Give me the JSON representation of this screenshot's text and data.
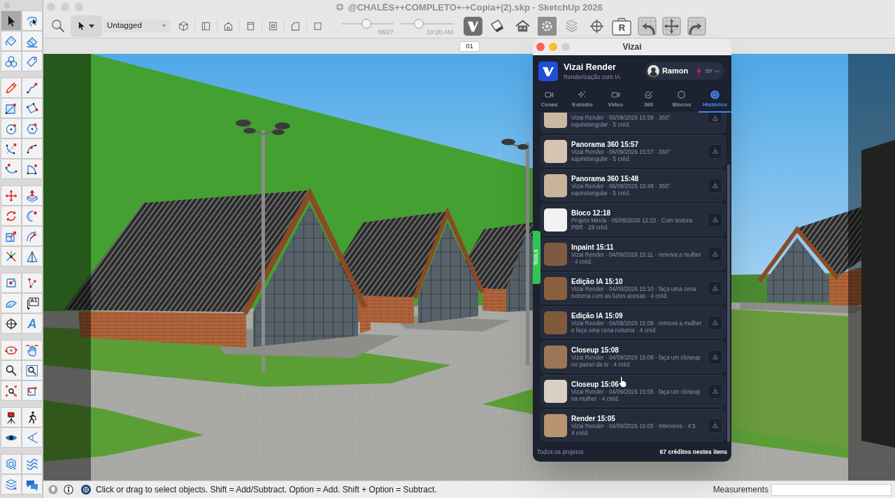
{
  "tool_palette": {
    "groups": [
      {
        "tools": [
          {
            "selected": true
          },
          {
            "selected": false
          },
          {
            "selected": false
          },
          {
            "selected": false
          },
          {
            "selected": false
          },
          {
            "selected": false
          }
        ]
      },
      {
        "tools": [
          {
            "selected": false
          },
          {
            "selected": false
          },
          {
            "selected": false
          },
          {
            "selected": false
          },
          {
            "selected": false
          },
          {
            "selected": false
          },
          {
            "selected": false
          },
          {
            "selected": false
          },
          {
            "selected": false
          },
          {
            "selected": false
          }
        ]
      },
      {
        "tools": [
          {
            "selected": false
          },
          {
            "selected": false
          },
          {
            "selected": false
          },
          {
            "selected": false
          },
          {
            "selected": false
          },
          {
            "selected": false
          },
          {
            "selected": false
          },
          {
            "selected": false
          }
        ]
      },
      {
        "tools": [
          {
            "selected": false
          },
          {
            "selected": false
          },
          {
            "selected": false
          },
          {
            "selected": false,
            "label": "A1"
          },
          {
            "selected": false
          },
          {
            "selected": false,
            "label": "A"
          }
        ]
      },
      {
        "tools": [
          {
            "selected": false
          },
          {
            "selected": false
          },
          {
            "selected": false
          },
          {
            "selected": false
          },
          {
            "selected": false
          },
          {
            "selected": false
          }
        ]
      },
      {
        "tools": [
          {
            "selected": false
          },
          {
            "selected": false
          },
          {
            "selected": false
          },
          {
            "selected": false
          }
        ]
      },
      {
        "tools": [
          {
            "selected": false
          },
          {
            "selected": false
          },
          {
            "selected": false
          },
          {
            "selected": false
          }
        ]
      }
    ]
  },
  "window": {
    "title": "@CHALÉS++COMPLETO+-+Copia+(2).skp - SketchUp 2026"
  },
  "toolbar": {
    "tag_dropdown": {
      "value": "Untagged"
    },
    "shadow_sliders": [
      {
        "level": 0.48,
        "reading": "08/27"
      },
      {
        "level": 0.35,
        "reading": "10:20 AM"
      }
    ],
    "render_camera_label": "R"
  },
  "scene_tabs": [
    {
      "label": "01"
    }
  ],
  "vizai": {
    "window_title": "Vizai",
    "brand": {
      "name": "Vizai Render",
      "tagline": "Renderização com IA"
    },
    "user": {
      "name": "Ramon",
      "credits": "59"
    },
    "tabs": [
      {
        "label": "Cenas",
        "selected": false
      },
      {
        "label": "Estúdio",
        "selected": false
      },
      {
        "label": "Vídeo",
        "selected": false
      },
      {
        "label": "360",
        "selected": false
      },
      {
        "label": "Blocos",
        "selected": false
      },
      {
        "label": "Histórico",
        "selected": true
      }
    ],
    "history": [
      {
        "details": "Vizai Render · 06/09/2026 15:59 · 360° equiretangular · 5 créd."
      },
      {
        "title": "Panorama 360 15:57",
        "details": "Vizai Render · 06/09/2026 15:57 · 360° equiretangular · 5 créd."
      },
      {
        "title": "Panorama 360 15:48",
        "details": "Vizai Render · 06/09/2026 15:48 · 360° equiretangular · 5 créd."
      },
      {
        "title": "Bloco 12:18",
        "details": "Projeto Mirela · 05/09/2026 12:22 · Com textura PBR · 28 créd."
      },
      {
        "title": "Inpaint 15:11",
        "details": "Vizai Render · 04/09/2026 15:11 · remova a mulher · 4 créd."
      },
      {
        "title": "Edição IA 15:10",
        "details": "Vizai Render · 04/09/2026 15:10 · faça uma cena noturna com as luzes acesas · 4 créd."
      },
      {
        "title": "Edição IA 15:09",
        "details": "Vizai Render · 04/09/2026 15:09 · remova a mulher e faça uma cena noturna · 4 créd."
      },
      {
        "title": "Closeup 15:08",
        "details": "Vizai Render · 04/09/2026 15:08 · faça um closeup no painel da tv · 4 créd."
      },
      {
        "title": "Closeup 15:06",
        "details": "Vizai Render · 04/09/2026 15:06 · faça um closeup na mulher · 4 créd."
      },
      {
        "title": "Render 15:05",
        "details": "Vizai Render · 04/09/2026 15:05 · Interiores · 4:5 · 4 créd."
      }
    ],
    "footer": {
      "scope": "Todos os projetos",
      "total": "67 créditos nestes itens"
    },
    "side_tab": {
      "label": "TOOLS"
    }
  },
  "status_bar": {
    "hint": "Click or drag to select objects. Shift = Add/Subtract. Option = Add. Shift + Option = Subtract.",
    "measurements_label": "Measurements"
  }
}
